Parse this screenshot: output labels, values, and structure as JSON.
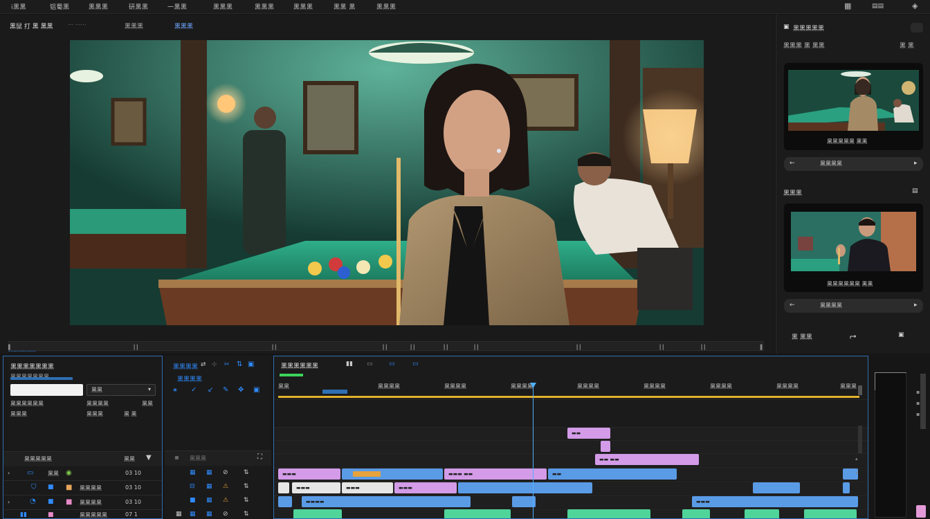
{
  "menu": {
    "items": [
      "ⅰ黑黑",
      "铝蜀黑",
      "黑黑黑",
      "研黑黑",
      "一黑黑",
      "黑黑黑",
      "黑黑黑",
      "黑黑黑",
      "黑黑 黑",
      "黑黑黑"
    ]
  },
  "viewer": {
    "tab1": "黑鼠 打 黑 黑黑",
    "tab2": "黑黑黑",
    "tab3": "黑黑黑",
    "timecode_label": "黑黑黑黑"
  },
  "right_panel": {
    "header": "黑黑黑黑黑",
    "subheader": "黑黑黑 黑 黑黑",
    "thumb1_caption": "黑黑黑黑黑 黑黑",
    "nav1_label": "黑黑黑黑",
    "section2": "黑黑黑",
    "thumb2_caption": "黑黑黑黑黑黑 黑黑",
    "nav2_label": "黑黑黑黑",
    "bottom_label": "黑 黑黑"
  },
  "effects_panel": {
    "title": "黑黑黑黑黑黑黑",
    "row1_label": "黑黑黑黑黑黑黑",
    "dropdown_value": "黑黑",
    "prop1": "黑黑黑黑黑黑",
    "prop2": "黑黑黑黑",
    "prop3": "黑黑",
    "prop4": "黑黑黑",
    "prop5": "黑黑黑",
    "list_header": "黑黑黑黑黑",
    "list_items": [
      {
        "name": "黑黑",
        "value": "03 10"
      },
      {
        "name": "黑黑黑黑",
        "value": "03 10"
      },
      {
        "name": "黑黑黑黑",
        "value": "03 10"
      },
      {
        "name": "黑黑黑黑黑",
        "value": "07 1"
      }
    ]
  },
  "tools_panel": {
    "title": "黑黑黑黑",
    "section": "黑黑黑黑",
    "sub": "黑黑黑"
  },
  "timeline": {
    "title": "黑黑黑黑黑黑",
    "ruler": [
      "黑黑",
      "黑黑黑黑",
      "黑黑黑黑",
      "黑黑黑黑",
      "黑黑黑黑",
      "黑黑黑黑",
      "黑黑黑黑",
      "黑黑黑黑",
      "黑黑黑"
    ]
  },
  "colors": {
    "accent": "#2f8bff",
    "selection": "#2f6fb3",
    "playhead": "#4fb0ff",
    "clip_blue": "#5a9be6",
    "clip_pink": "#d39be8",
    "clip_green": "#4fd49a",
    "clip_white": "#e6e6e6",
    "timeline_ruler": "#e3b12b"
  }
}
